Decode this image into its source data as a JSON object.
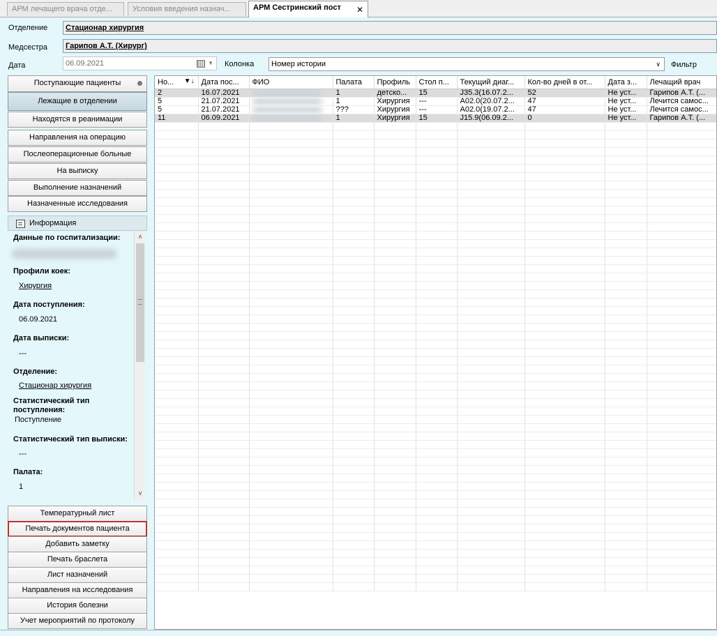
{
  "tabs": [
    {
      "label": "АРМ лечащего врача отде..."
    },
    {
      "label": "Условия введения назнач..."
    },
    {
      "label": "АРМ Сестринский пост",
      "close": "✕"
    }
  ],
  "header": {
    "department_label": "Отделение",
    "department_value": "Стационар хирургия",
    "nurse_label": "Медсестра",
    "nurse_value": "Гарипов А.Т. (Хирург)",
    "date_label": "Дата",
    "date_value": "06.09.2021",
    "column_label": "Колонка",
    "column_value": "Номер истории",
    "filter_label": "Фильтр"
  },
  "nav": [
    "Поступающие пациенты",
    "Лежащие в отделении",
    "Находятся в реанимации",
    "Направления на операцию",
    "Послеоперационные больные",
    "На выписку",
    "Выполнение назначений",
    "Назначенные исследования"
  ],
  "info": {
    "title": "Информация",
    "hosp_label": "Данные по госпитализации:",
    "profiles_label": "Профили коек:",
    "profiles_value": "Хирургия",
    "admit_label": "Дата поступления:",
    "admit_value": "06.09.2021",
    "discharge_label": "Дата выписки:",
    "discharge_value": "---",
    "dept_label": "Отделение:",
    "dept_value": "Стационар хирургия",
    "stat_in_label": "Статистический тип поступления:",
    "stat_in_value": "Поступление",
    "stat_out_label": "Статистический тип выписки:",
    "stat_out_value": "---",
    "ward_label": "Палата:",
    "ward_value": "1"
  },
  "actions": [
    "Температурный лист",
    "Печать документов пациента",
    "Добавить заметку",
    "Печать браслета",
    "Лист назначений",
    "Направления на исследования",
    "История болезни",
    "Учет мероприятий по протоколу"
  ],
  "grid": {
    "columns": [
      "Но...",
      "Дата пос...",
      "ФИО",
      "Палата",
      "Профиль",
      "Стол п...",
      "Текущий диаг...",
      "Кол-во дней в от...",
      "Дата з...",
      "Лечащий врач"
    ],
    "rows": [
      [
        "2",
        "16.07.2021",
        "",
        "1",
        "детско...",
        "15",
        "J35.3(16.07.2...",
        "52",
        "Не уст...",
        "Гарипов А.Т. (..."
      ],
      [
        "5",
        "21.07.2021",
        "",
        "1",
        "Хирургия",
        "---",
        "A02.0(20.07.2...",
        "47",
        "Не уст...",
        "Лечится самос..."
      ],
      [
        "5",
        "21.07.2021",
        "",
        "???",
        "Хирургия",
        "---",
        "A02.0(19.07.2...",
        "47",
        "Не уст...",
        "Лечится самос..."
      ],
      [
        "11",
        "06.09.2021",
        "",
        "1",
        "Хирургия",
        "15",
        "J15.9(06.09.2...",
        "0",
        "Не уст...",
        "Гарипов А.Т. (..."
      ]
    ]
  }
}
